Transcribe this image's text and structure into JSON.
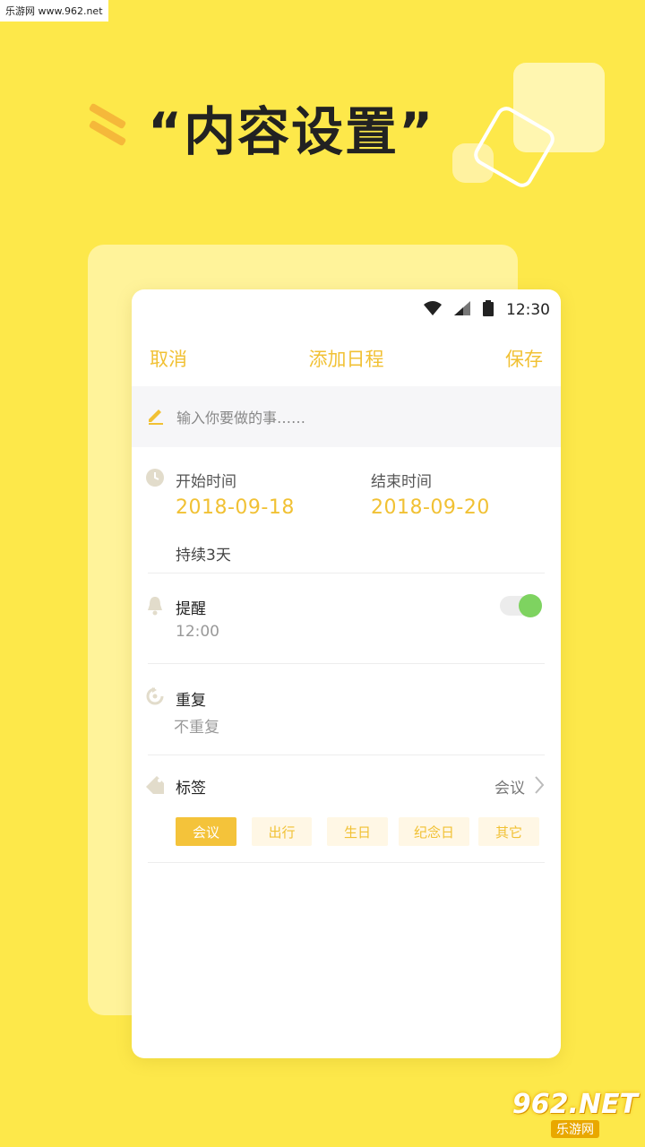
{
  "watermark": {
    "top_text": "乐游网 www.962.net",
    "bottom_logo": "962.NET",
    "bottom_sub": "乐游网"
  },
  "headline": "“内容设置”",
  "status_bar": {
    "time": "12:30"
  },
  "nav": {
    "cancel": "取消",
    "title": "添加日程",
    "save": "保存"
  },
  "task_input": {
    "placeholder": "输入你要做的事……"
  },
  "schedule": {
    "start_label": "开始时间",
    "start_value": "2018-09-18",
    "end_label": "结束时间",
    "end_value": "2018-09-20",
    "duration": "持续3天"
  },
  "reminder": {
    "label": "提醒",
    "time": "12:00",
    "enabled": true
  },
  "repeat": {
    "label": "重复",
    "value": "不重复"
  },
  "tags": {
    "label": "标签",
    "selected": "会议",
    "options": [
      "会议",
      "出行",
      "生日",
      "纪念日",
      "其它"
    ]
  },
  "colors": {
    "background": "#FDE84A",
    "accent": "#F1C134",
    "toggle_on": "#7ED360"
  }
}
